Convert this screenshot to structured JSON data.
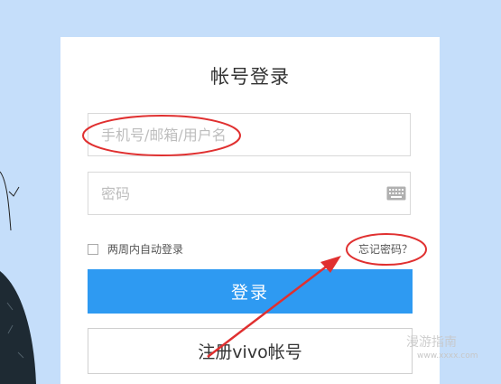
{
  "login": {
    "title": "帐号登录",
    "username_placeholder": "手机号/邮箱/用户名",
    "password_placeholder": "密码",
    "keyboard_icon": "keyboard-icon",
    "remember_label": "两周内自动登录",
    "remember_checked": false,
    "forgot_label": "忘记密码？",
    "login_button": "登录",
    "register_button": "注册vivo帐号"
  },
  "watermark": {
    "text": "漫游指南",
    "sub": "www.xxxx.com"
  },
  "colors": {
    "background": "#c5defa",
    "primary": "#2e9af2",
    "annotation": "#e03030"
  }
}
